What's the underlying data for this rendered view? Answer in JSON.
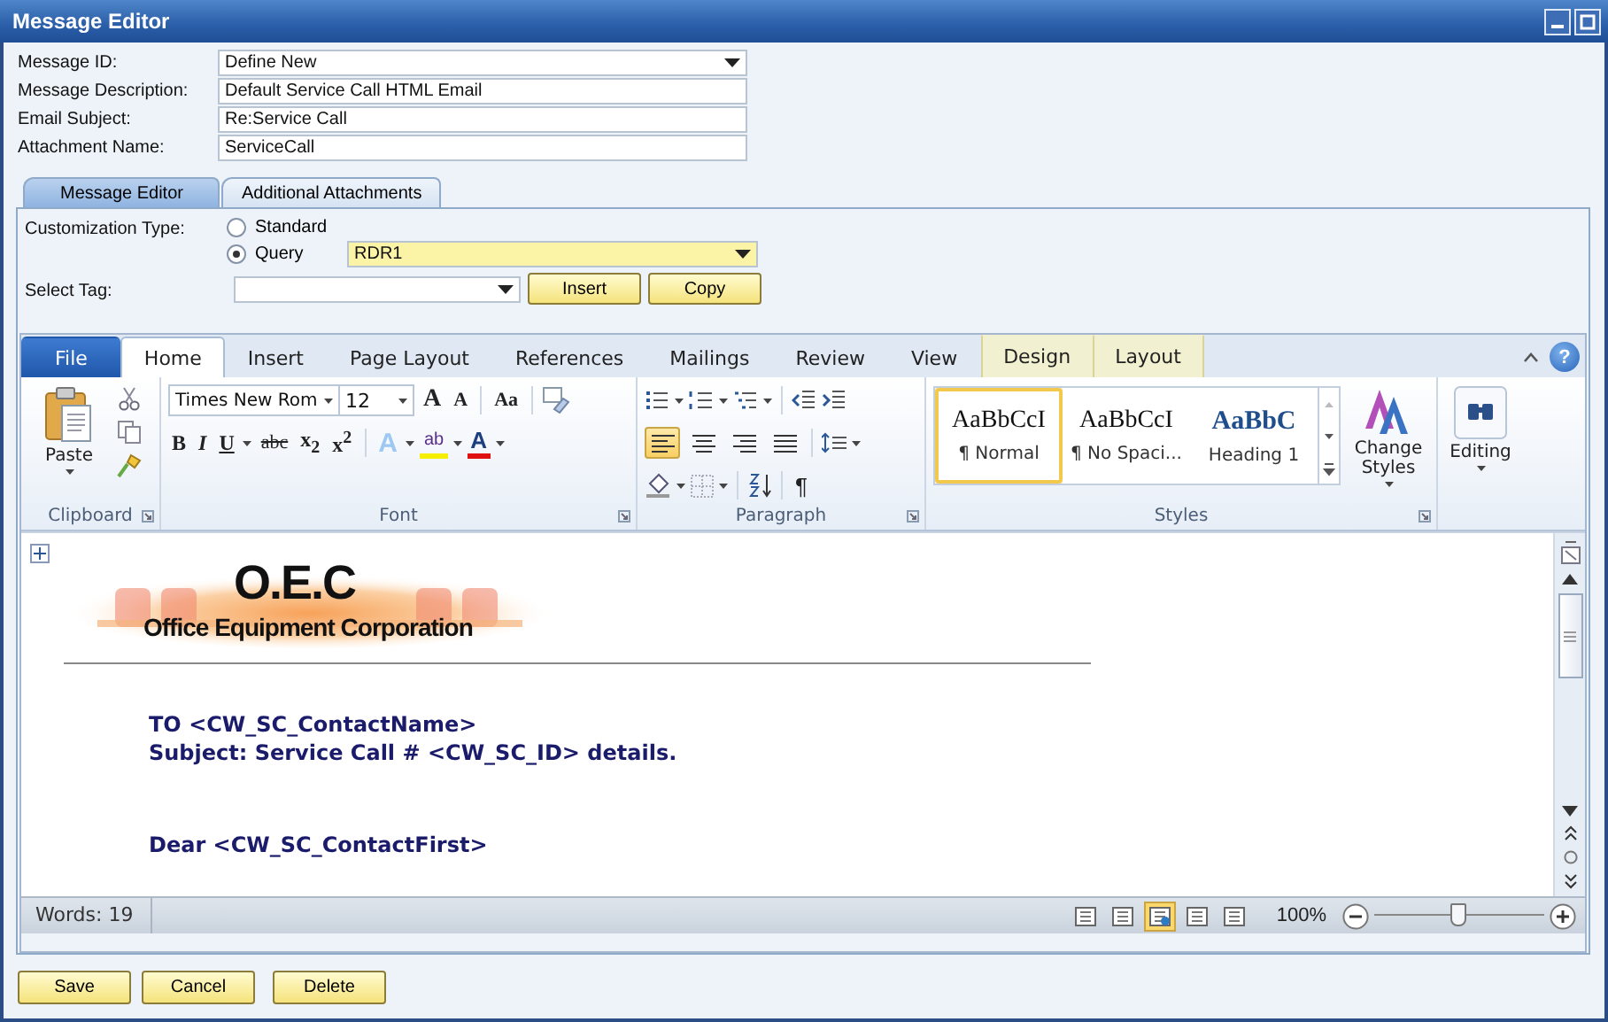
{
  "window": {
    "title": "Message Editor"
  },
  "fields": [
    {
      "label": "Message ID:",
      "value": "Define New",
      "kind": "dropdown"
    },
    {
      "label": "Message Description:",
      "value": "Default Service Call HTML Email",
      "kind": "text"
    },
    {
      "label": "Email Subject:",
      "value": "Re:Service Call",
      "kind": "text"
    },
    {
      "label": "Attachment Name:",
      "value": "ServiceCall",
      "kind": "text"
    }
  ],
  "tabs": [
    {
      "label": "Message Editor",
      "selected": true
    },
    {
      "label": "Additional Attachments",
      "selected": false
    }
  ],
  "customization": {
    "label": "Customization Type:",
    "options": [
      {
        "label": "Standard",
        "selected": false
      },
      {
        "label": "Query",
        "selected": true
      }
    ],
    "query_value": "RDR1"
  },
  "select_tag": {
    "label": "Select Tag:",
    "buttons": [
      "Insert",
      "Copy"
    ]
  },
  "ribbon": {
    "tabs": [
      {
        "label": "File",
        "kind": "file",
        "selected": false
      },
      {
        "label": "Home",
        "kind": "normal",
        "selected": true
      },
      {
        "label": "Insert",
        "kind": "normal",
        "selected": false
      },
      {
        "label": "Page Layout",
        "kind": "normal",
        "selected": false
      },
      {
        "label": "References",
        "kind": "normal",
        "selected": false
      },
      {
        "label": "Mailings",
        "kind": "normal",
        "selected": false
      },
      {
        "label": "Review",
        "kind": "normal",
        "selected": false
      },
      {
        "label": "View",
        "kind": "normal",
        "selected": false
      },
      {
        "label": "Design",
        "kind": "contextual",
        "selected": false
      },
      {
        "label": "Layout",
        "kind": "contextual",
        "selected": false
      }
    ],
    "help": "?",
    "clipboard": {
      "paste": "Paste",
      "label": "Clipboard"
    },
    "font": {
      "name": "Times New Rom",
      "size": "12",
      "grow": "A",
      "shrink": "A",
      "case": "Aa",
      "format": [
        "B",
        "I",
        "U",
        "abc",
        "x$_{2}$",
        "x$^{2}$"
      ],
      "effects": "A",
      "highlight": "ab",
      "font_color": "A",
      "label": "Font"
    },
    "paragraph": {
      "align": [
        {
          "selected": true
        },
        {
          "selected": false
        },
        {
          "selected": false
        },
        {
          "selected": false
        }
      ],
      "pilcrow": "¶",
      "label": "Paragraph"
    },
    "styles": {
      "items": [
        {
          "preview": "AaBbCcI",
          "name": "¶ Normal",
          "selected": true,
          "kind": "body"
        },
        {
          "preview": "AaBbCcI",
          "name": "¶ No Spaci...",
          "selected": false,
          "kind": "body"
        },
        {
          "preview": "AaBbC",
          "name": "Heading 1",
          "selected": false,
          "kind": "heading"
        }
      ],
      "change": "Change Styles",
      "label": "Styles"
    },
    "editing": "Editing"
  },
  "document": {
    "logo_title": "O.E.C",
    "logo_subtitle": "Office Equipment Corporation",
    "lines": [
      "TO <CW_SC_ContactName>",
      "Subject: Service Call # <CW_SC_ID> details."
    ],
    "greeting": "Dear <CW_SC_ContactFirst>"
  },
  "status_bar": {
    "words": "Words: 19",
    "views": [
      {
        "selected": false
      },
      {
        "selected": false
      },
      {
        "selected": true
      },
      {
        "selected": false
      },
      {
        "selected": false
      }
    ],
    "zoom": "100%",
    "zoom_slider": {
      "level": 0.5
    }
  },
  "buttons": [
    "Save",
    "Cancel",
    "Delete"
  ]
}
